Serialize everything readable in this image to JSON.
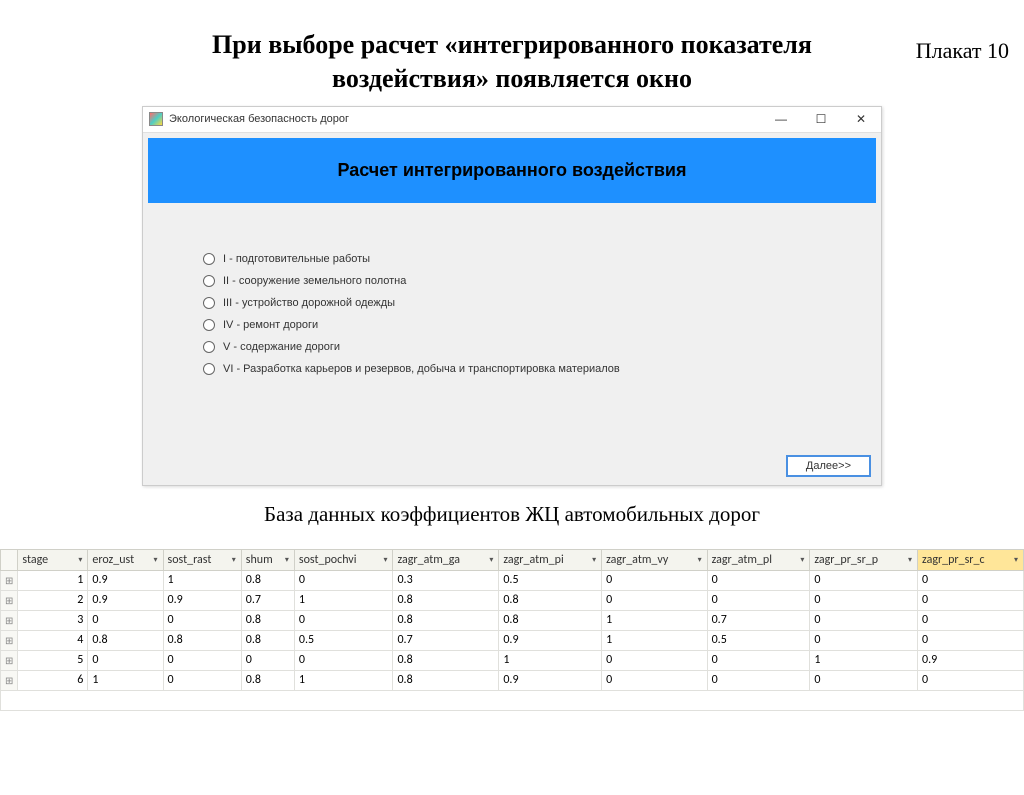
{
  "poster_label": "Плакат 10",
  "main_title_l1": "При выборе расчет «интегрированного показателя",
  "main_title_l2": "воздействия» появляется окно",
  "window": {
    "title": "Экологическая безопасность дорог",
    "minimize": "—",
    "maximize": "☐",
    "close": "✕",
    "banner": "Расчет интегрированного воздействия",
    "radios": [
      "I - подготовительные работы",
      "II - сооружение земельного полотна",
      "III - устройство дорожной одежды",
      "IV - ремонт дороги",
      "V - содержание дороги",
      "VI - Разработка карьеров и резервов, добыча и транспортировка материалов"
    ],
    "next_btn": "Далее>>"
  },
  "db_caption": "База данных коэффициентов ЖЦ автомобильных дорог",
  "table": {
    "headers": [
      "stage",
      "eroz_ust",
      "sost_rast",
      "shum",
      "sost_pochvi",
      "zagr_atm_ga",
      "zagr_atm_pi",
      "zagr_atm_vy",
      "zagr_atm_pl",
      "zagr_pr_sr_p",
      "zagr_pr_sr_c"
    ],
    "rows": [
      {
        "stage": "1",
        "cells": [
          "0.9",
          "1",
          "0.8",
          "0",
          "0.3",
          "0.5",
          "0",
          "0",
          "0",
          "0"
        ]
      },
      {
        "stage": "2",
        "cells": [
          "0.9",
          "0.9",
          "0.7",
          "1",
          "0.8",
          "0.8",
          "0",
          "0",
          "0",
          "0"
        ]
      },
      {
        "stage": "3",
        "cells": [
          "0",
          "0",
          "0.8",
          "0",
          "0.8",
          "0.8",
          "1",
          "0.7",
          "0",
          "0"
        ]
      },
      {
        "stage": "4",
        "cells": [
          "0.8",
          "0.8",
          "0.8",
          "0.5",
          "0.7",
          "0.9",
          "1",
          "0.5",
          "0",
          "0"
        ]
      },
      {
        "stage": "5",
        "cells": [
          "0",
          "0",
          "0",
          "0",
          "0.8",
          "1",
          "0",
          "0",
          "1",
          "0.9"
        ]
      },
      {
        "stage": "6",
        "cells": [
          "1",
          "0",
          "0.8",
          "1",
          "0.8",
          "0.9",
          "0",
          "0",
          "0",
          "0"
        ]
      }
    ]
  }
}
